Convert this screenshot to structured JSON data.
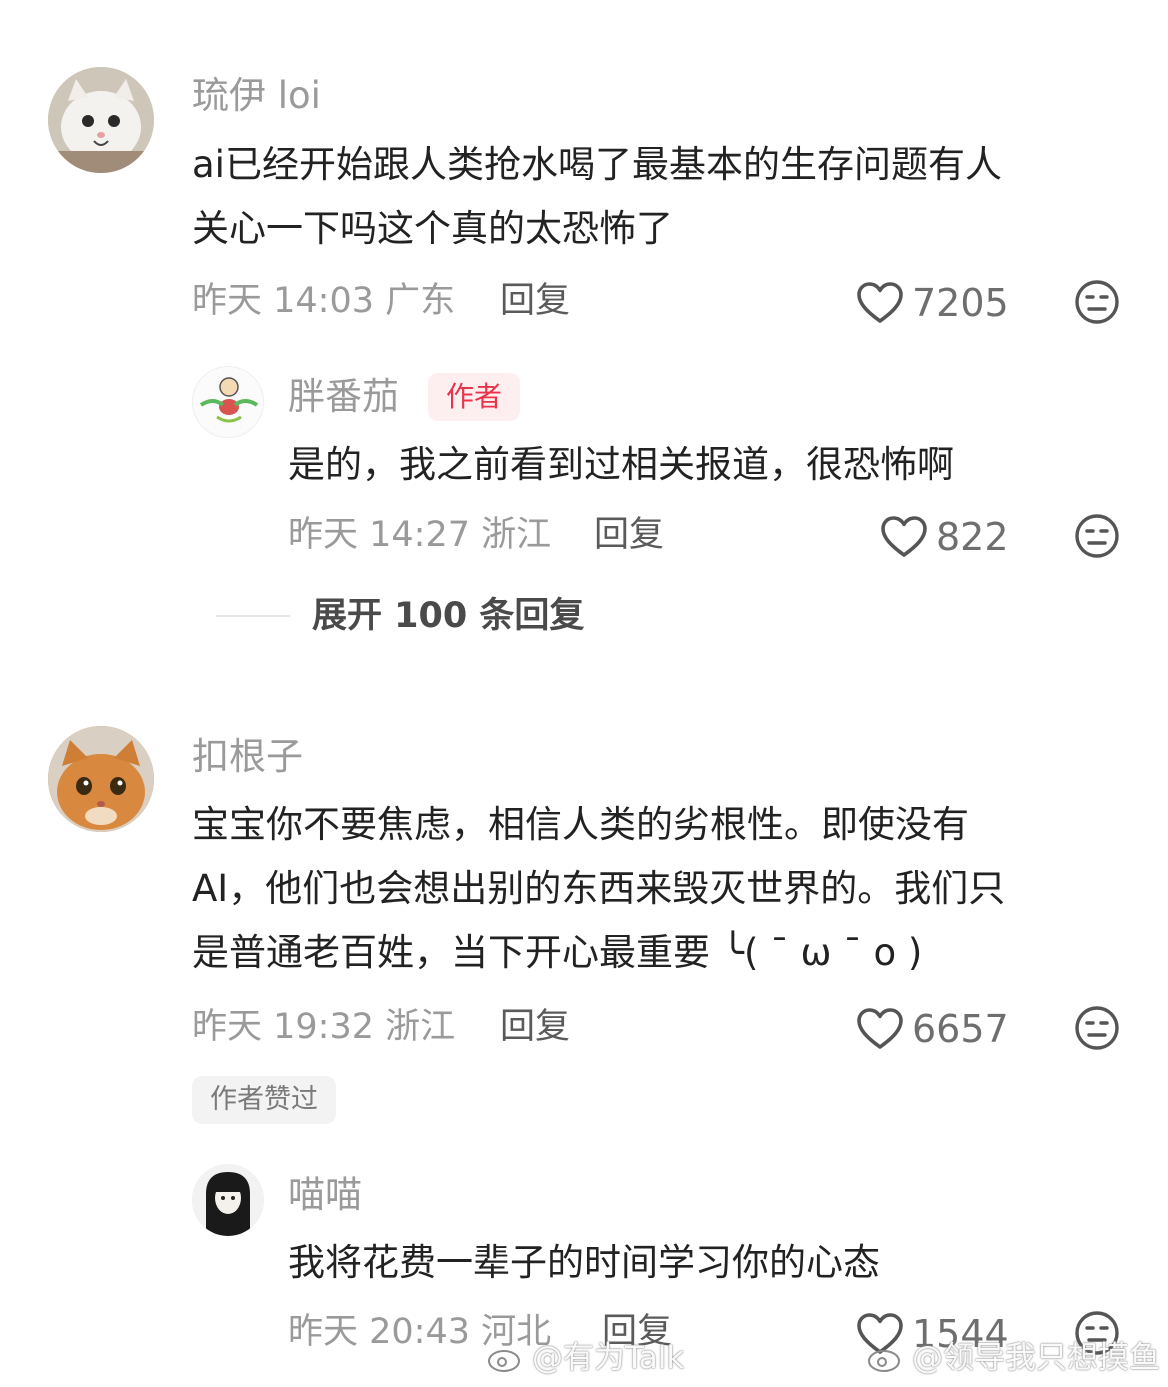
{
  "comments": [
    {
      "user": "琉伊 loi",
      "text_lines": [
        "ai已经开始跟人类抢水喝了最基本的生存问题有人",
        "关心一下吗这个真的太恐怖了"
      ],
      "time": "昨天 14:03 广东",
      "reply_label": "回复",
      "likes": "7205",
      "reply": {
        "user": "胖番茄",
        "badge": "作者",
        "text": "是的，我之前看到过相关报道，很恐怖啊",
        "time": "昨天 14:27 浙江",
        "reply_label": "回复",
        "likes": "822"
      },
      "expand_label": "展开 100 条回复"
    },
    {
      "user": "扣根子",
      "text_lines": [
        "宝宝你不要焦虑，相信人类的劣根性。即使没有",
        "AI，他们也会想出别的东西来毁灭世界的。我们只",
        "是普通老百姓，当下开心最重要 ╰( ¯ ω ¯ o )"
      ],
      "time": "昨天 19:32 浙江",
      "reply_label": "回复",
      "likes": "6657",
      "liked_by_author": "作者赞过",
      "reply": {
        "user": "喵喵",
        "text": "我将花费一辈子的时间学习你的心态",
        "time": "昨天 20:43 河北",
        "reply_label": "回复",
        "likes": "1544"
      }
    }
  ],
  "watermarks": [
    "@有为Talk",
    "@领导我只想摸鱼"
  ],
  "colors": {
    "author_badge": "#e8334a",
    "meta_gray": "#9a9a9a",
    "text": "#222222"
  }
}
